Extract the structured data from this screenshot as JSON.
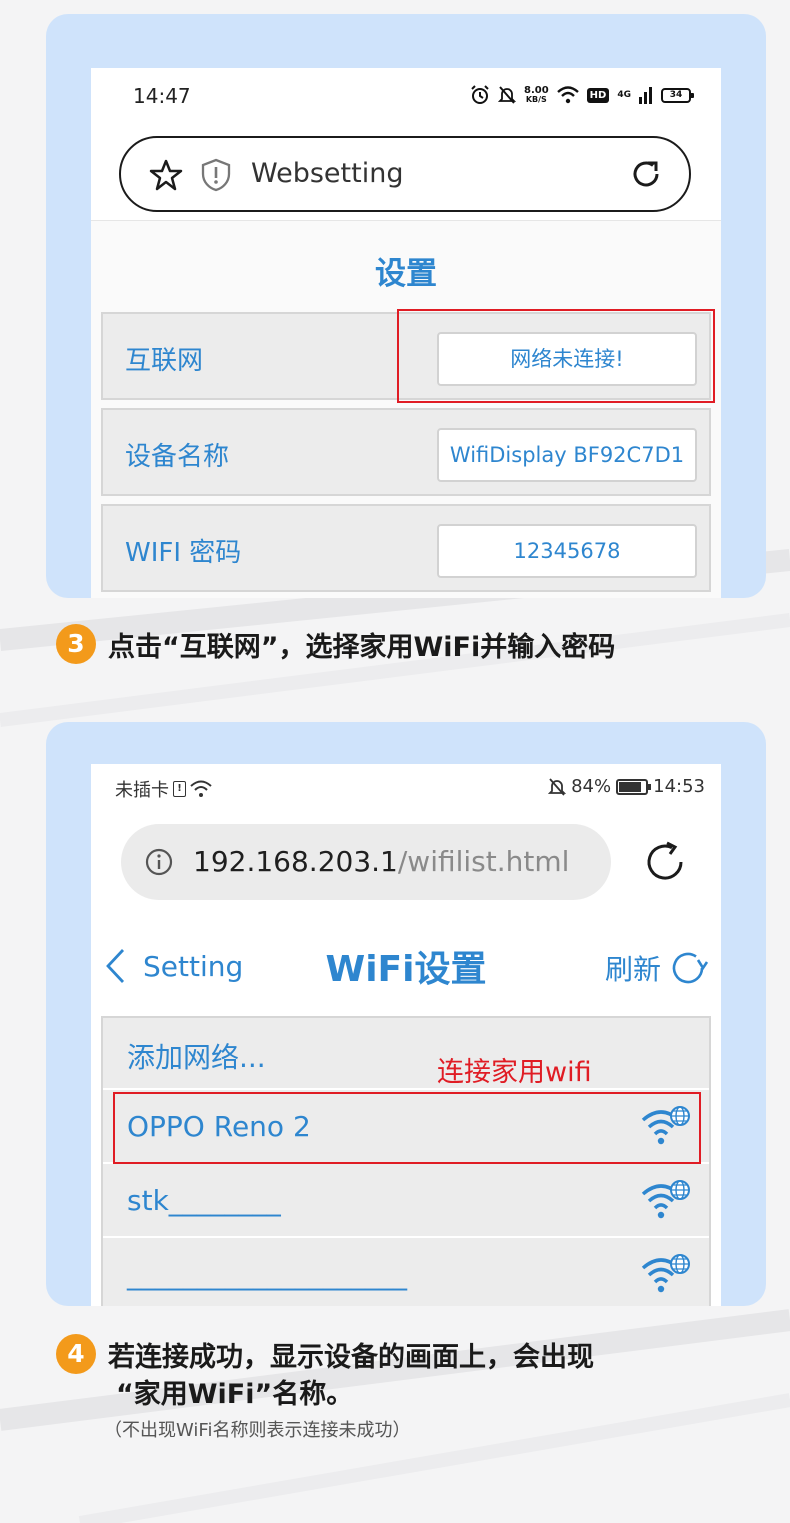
{
  "card1": {
    "statusbar": {
      "time": "14:47",
      "speed_value": "8.00",
      "speed_unit": "KB/S",
      "hd": "HD",
      "network": "4G",
      "battery": "34"
    },
    "browser": {
      "url": "Websetting"
    },
    "page": {
      "title": "设置",
      "rows": [
        {
          "label": "互联网",
          "value": "网络未连接!"
        },
        {
          "label": "设备名称",
          "value": "WifiDisplay BF92C7D1"
        },
        {
          "label": "WIFI 密码",
          "value": "12345678"
        }
      ]
    }
  },
  "step3": {
    "number": "3",
    "text": "点击“互联网”，选择家用WiFi并输入密码"
  },
  "card2": {
    "statusbar": {
      "carrier": "未插卡",
      "battery_percent": "84%",
      "time": "14:53"
    },
    "browser": {
      "host": "192.168.203.1",
      "path": "/wifilist.html"
    },
    "nav": {
      "back_label": "Setting",
      "title": "WiFi设置",
      "refresh_label": "刷新"
    },
    "wifi_list": [
      {
        "name": "添加网络..."
      },
      {
        "name": "OPPO Reno 2"
      },
      {
        "name": "stk________"
      },
      {
        "name": "____________________"
      }
    ],
    "callout": "连接家用wifi"
  },
  "step4": {
    "number": "4",
    "line1": "若连接成功，显示设备的画面上，会出现",
    "line2": "“家用WiFi”名称。",
    "note": "（不出现WiFi名称则表示连接未成功）"
  },
  "colors": {
    "accent_blue": "#2e86cf",
    "highlight_red": "#e01c24",
    "badge_orange": "#f39a1b",
    "card_bg": "#cfe3fb"
  }
}
